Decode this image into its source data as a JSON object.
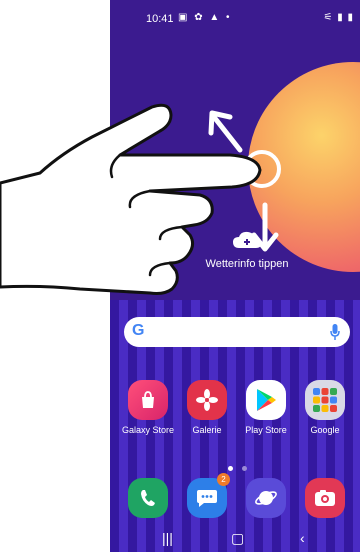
{
  "status_bar": {
    "time": "10:41",
    "left_icons": "▣ ✿ ▲ •",
    "right_icons": "⚟ ▮ ▮"
  },
  "weather": {
    "label": "Wetterinfo tippen",
    "icon": "cloud-upload-icon"
  },
  "search": {
    "logo": "G",
    "icon": "mic-icon"
  },
  "apps_row1": [
    {
      "label": "Galaxy Store",
      "icon": "shopping-bag-icon",
      "color": "#e8327c"
    },
    {
      "label": "Galerie",
      "icon": "flower-icon",
      "color": "#e2334a"
    },
    {
      "label": "Play Store",
      "icon": "play-triangle-icon",
      "color": "#ffffff"
    },
    {
      "label": "Google",
      "icon": "app-folder-icon",
      "color": "#d9d9e6"
    }
  ],
  "dock": [
    {
      "icon": "phone-icon",
      "color": "#1fa463"
    },
    {
      "icon": "message-icon",
      "color": "#2d7fe8",
      "badge": "2"
    },
    {
      "icon": "internet-icon",
      "color": "#5a4bd8"
    },
    {
      "icon": "camera-icon",
      "color": "#e23855"
    }
  ],
  "page_indicator": {
    "count": 2,
    "active": 0
  },
  "nav": {
    "recent": "|||",
    "home": "▢",
    "back": "‹"
  },
  "colors": {
    "wallpaper": "#3b1b8f",
    "sun_start": "#fcd36a",
    "sun_end": "#e24a6f"
  }
}
